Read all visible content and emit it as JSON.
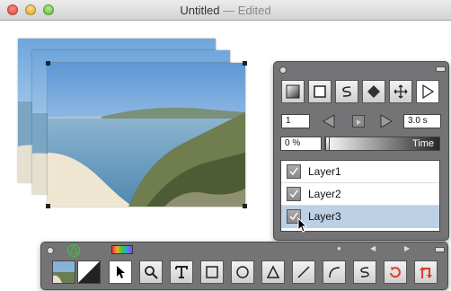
{
  "window": {
    "title": "Untitled",
    "title_suffix": " — Edited"
  },
  "timeline": {
    "frame": "1",
    "duration": "3.0 s",
    "time_value": "0 %",
    "time_label": "Time",
    "progress": 0.0
  },
  "layers": [
    {
      "label": "Layer1",
      "checked": true,
      "selected": false
    },
    {
      "label": "Layer2",
      "checked": true,
      "selected": false
    },
    {
      "label": "Layer3",
      "checked": true,
      "selected": true
    }
  ],
  "tools": {
    "shape_tools": [
      "gradient-fill-icon",
      "square-icon",
      "s-curve-icon",
      "diamond-icon",
      "move-arrows-icon",
      "play-triangle-icon"
    ],
    "bottom_tools": [
      "arrow-pointer-icon",
      "magnifier-icon",
      "text-tool-icon",
      "rectangle-tool-icon",
      "ellipse-tool-icon",
      "triangle-tool-icon",
      "line-tool-icon",
      "arc-tool-icon",
      "s-curve-tool-icon",
      "rotate-tool-icon",
      "transform-tool-icon"
    ]
  },
  "colors": {
    "hud_bg": "#6e6e70",
    "selected_row": "#bcd1e6",
    "rotate_red": "#e03a2a",
    "transform_red": "#e03a2a",
    "tag_green": "#4caf50"
  }
}
